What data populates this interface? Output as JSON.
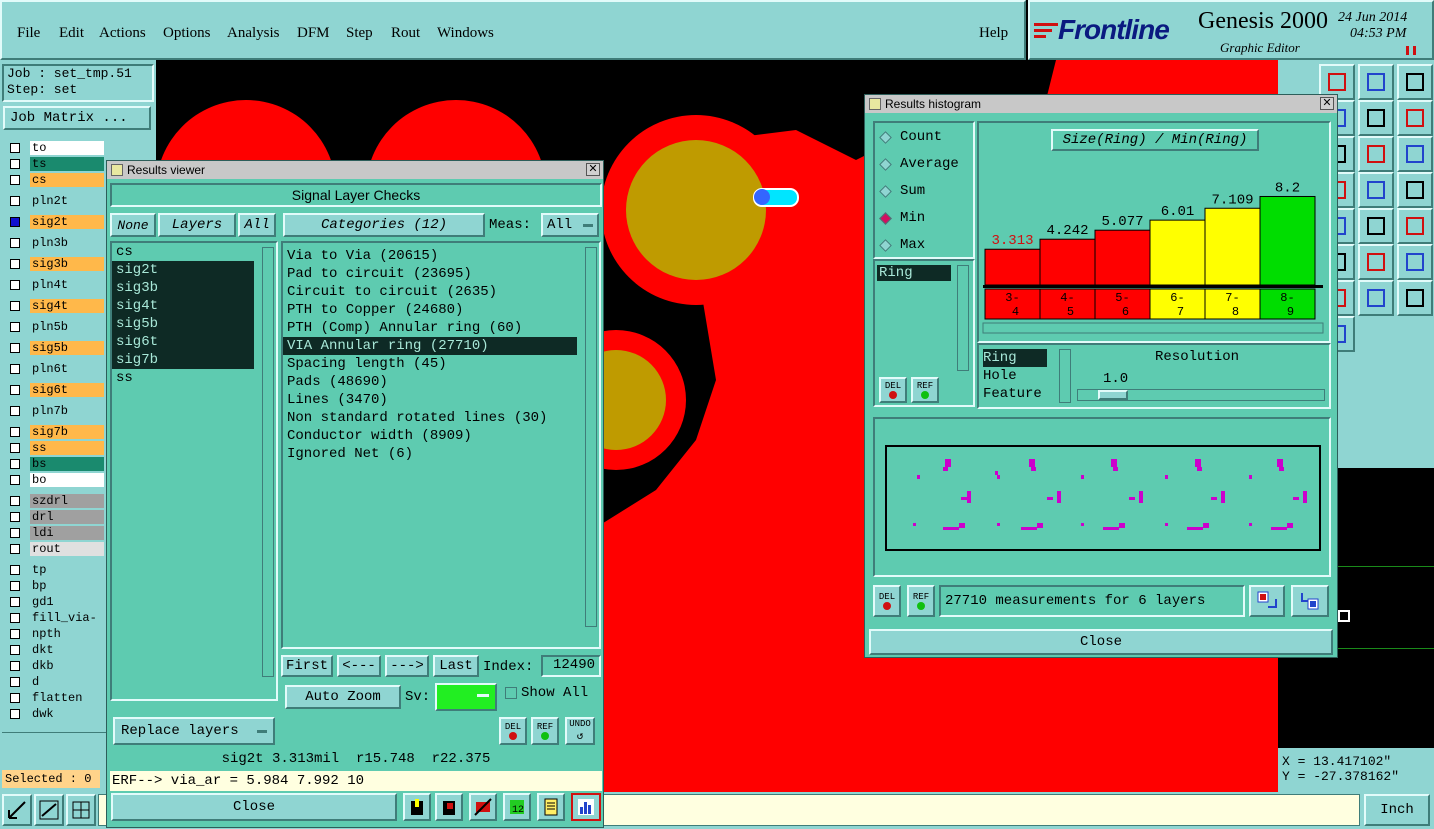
{
  "menu": {
    "file": "File",
    "edit": "Edit",
    "actions": "Actions",
    "options": "Options",
    "analysis": "Analysis",
    "dfm": "DFM",
    "step": "Step",
    "rout": "Rout",
    "windows": "Windows",
    "help": "Help"
  },
  "brand": {
    "logo": "Frontline",
    "product": "Genesis 2000",
    "subtitle": "Graphic Editor",
    "date": "24 Jun 2014",
    "time": "04:53 PM"
  },
  "left": {
    "job": "Job : set_tmp.51",
    "step": "Step: set",
    "job_matrix": "Job Matrix ...",
    "selected": "Selected : 0",
    "layers": [
      {
        "name": "to",
        "color": "#ffffff"
      },
      {
        "name": "ts",
        "color": "#1a8a6e"
      },
      {
        "name": "cs",
        "color": "#ffb84a"
      },
      {
        "name": "pln2t",
        "color": "#8fd5d2"
      },
      {
        "name": "sig2t",
        "color": "#ffb84a"
      },
      {
        "name": "pln3b",
        "color": "#8fd5d2"
      },
      {
        "name": "sig3b",
        "color": "#ffb84a"
      },
      {
        "name": "pln4t",
        "color": "#8fd5d2"
      },
      {
        "name": "sig4t",
        "color": "#ffb84a"
      },
      {
        "name": "pln5b",
        "color": "#8fd5d2"
      },
      {
        "name": "sig5b",
        "color": "#ffb84a"
      },
      {
        "name": "pln6t",
        "color": "#8fd5d2"
      },
      {
        "name": "sig6t",
        "color": "#ffb84a"
      },
      {
        "name": "pln7b",
        "color": "#8fd5d2"
      },
      {
        "name": "sig7b",
        "color": "#ffb84a"
      },
      {
        "name": "ss",
        "color": "#ffb84a"
      },
      {
        "name": "bs",
        "color": "#1a8a6e"
      },
      {
        "name": "bo",
        "color": "#ffffff"
      },
      {
        "name": "szdrl",
        "color": "#a0a0a0"
      },
      {
        "name": "drl",
        "color": "#a0a0a0"
      },
      {
        "name": "ldi",
        "color": "#a0a0a0"
      },
      {
        "name": "rout",
        "color": "#e0e0e0"
      },
      {
        "name": "tp",
        "color": "#8fd5d2"
      },
      {
        "name": "bp",
        "color": "#8fd5d2"
      },
      {
        "name": "gd1",
        "color": "#8fd5d2"
      },
      {
        "name": "fill_via-",
        "color": "#8fd5d2"
      },
      {
        "name": "npth",
        "color": "#8fd5d2"
      },
      {
        "name": "dkt",
        "color": "#8fd5d2"
      },
      {
        "name": "dkb",
        "color": "#8fd5d2"
      },
      {
        "name": "d",
        "color": "#8fd5d2"
      },
      {
        "name": "flatten",
        "color": "#8fd5d2"
      },
      {
        "name": "dwk",
        "color": "#8fd5d2"
      }
    ]
  },
  "rv": {
    "title": "Results viewer",
    "header": "Signal Layer Checks",
    "none": "None",
    "layers": "Layers",
    "all": "All",
    "categories_btn": "Categories (12)",
    "meas_label": "Meas:",
    "meas_value": "All",
    "layer_list": [
      "cs",
      "sig2t",
      "sig3b",
      "sig4t",
      "sig5b",
      "sig6t",
      "sig7b",
      "ss"
    ],
    "categories": [
      "Via to Via (20615)",
      "Pad to circuit (23695)",
      "Circuit to circuit (2635)",
      "PTH to Copper (24680)",
      "PTH (Comp) Annular ring (60)",
      "VIA Annular ring (27710)",
      "Spacing length (45)",
      "Pads (48690)",
      "Lines (3470)",
      "Non standard rotated lines (30)",
      "Conductor width (8909)",
      "Ignored Net (6)"
    ],
    "first": "First",
    "prev": "<---",
    "next": "--->",
    "last": "Last",
    "index_label": "Index:",
    "index_value": "12490",
    "auto_zoom": "Auto Zoom",
    "sv": "Sv:",
    "show_all": "Show All",
    "replace_layers": "Replace layers",
    "del": "DEL",
    "ref": "REF",
    "undo": "UNDO",
    "status": "sig2t 3.313mil  r15.748  r22.375",
    "erf": "ERF--> via_ar = 5.984 7.992 10",
    "close": "Close"
  },
  "hist": {
    "title": "Results histogram",
    "options": [
      "Count",
      "Average",
      "Sum",
      "Min",
      "Max"
    ],
    "selected_option": "Min",
    "chart_title": "Size(Ring) / Min(Ring)",
    "list_item": "Ring",
    "types": [
      "Ring",
      "Hole",
      "Feature"
    ],
    "resolution_label": "Resolution",
    "resolution_value": "1.0",
    "summary": "27710 measurements for 6 layers",
    "close": "Close",
    "del": "DEL",
    "ref": "REF"
  },
  "chart_data": {
    "type": "bar",
    "title": "Size(Ring) / Min(Ring)",
    "categories": [
      "3-4",
      "4-5",
      "5-6",
      "6-7",
      "7-8",
      "8-9"
    ],
    "values": [
      3.313,
      4.242,
      5.077,
      6.01,
      7.109,
      8.2
    ],
    "value_labels": [
      "3.313",
      "4.242",
      "5.077",
      "6.01",
      "7.109",
      "8.2"
    ],
    "colors": [
      "#ff0000",
      "#ff0000",
      "#ff0000",
      "#ffff00",
      "#ffff00",
      "#00dd00"
    ],
    "ylim": [
      0,
      8.8
    ]
  },
  "coords": {
    "x": "X = 13.417102\"",
    "y": "Y = -27.378162\""
  },
  "units": "Inch"
}
